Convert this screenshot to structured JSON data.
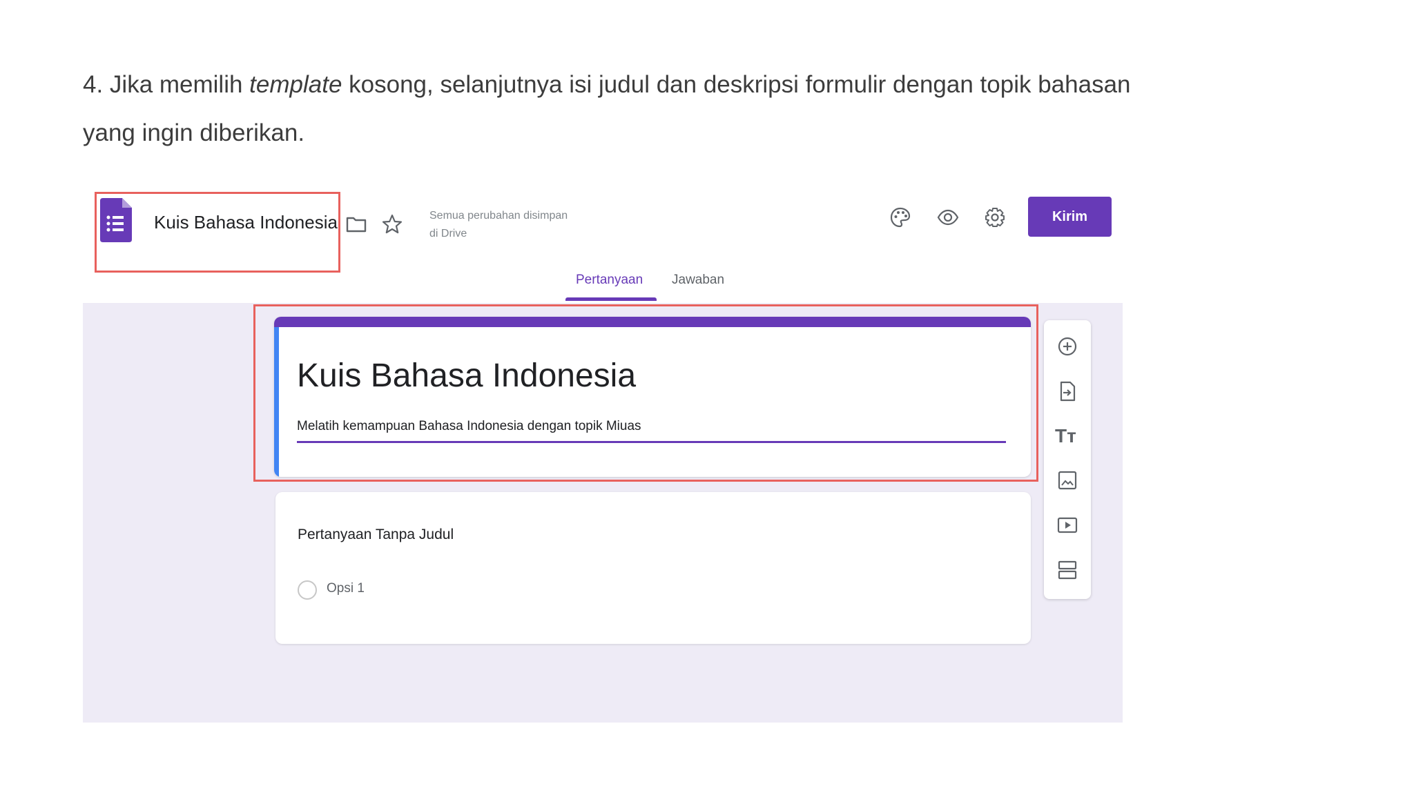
{
  "article": {
    "step_prefix": "4. Jika memilih ",
    "step_italic": "template",
    "step_rest": " kosong, selanjutnya isi judul dan deskripsi formulir dengan topik bahasan yang ingin diberikan."
  },
  "header": {
    "doc_title": "Kuis Bahasa Indonesia",
    "save_status_line1": "Semua perubahan disimpan",
    "save_status_line2": "di Drive",
    "send_label": "Kirim"
  },
  "tabs": [
    {
      "label": "Pertanyaan",
      "active": true
    },
    {
      "label": "Jawaban",
      "active": false
    }
  ],
  "form": {
    "title": "Kuis Bahasa Indonesia",
    "description": "Melatih kemampuan Bahasa Indonesia dengan topik Miuas"
  },
  "question": {
    "title": "Pertanyaan Tanpa Judul",
    "option_label": "Opsi 1"
  },
  "toolbar": {
    "icons": [
      "add-question-icon",
      "import-questions-icon",
      "add-title-icon",
      "add-image-icon",
      "add-video-icon",
      "add-section-icon"
    ],
    "title_glyph": "Tт"
  },
  "colors": {
    "accent": "#673ab7",
    "highlight": "#e8615d",
    "form_bg": "#eeebf6",
    "description_bar": "#4285f4"
  }
}
